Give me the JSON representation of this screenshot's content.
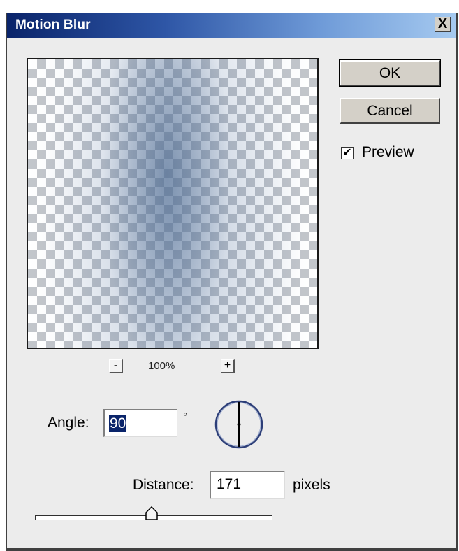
{
  "window": {
    "title": "Motion Blur",
    "close_glyph": "X"
  },
  "buttons": {
    "ok_label": "OK",
    "cancel_label": "Cancel"
  },
  "preview_option": {
    "label": "Preview",
    "checked": true,
    "check_glyph": "✔"
  },
  "zoom": {
    "minus_glyph": "-",
    "plus_glyph": "+",
    "level": "100%"
  },
  "angle": {
    "label": "Angle:",
    "value": "90",
    "unit_symbol": "°",
    "dial_icon": "angle-dial-icon"
  },
  "distance": {
    "label": "Distance:",
    "value": "171",
    "unit": "pixels",
    "slider_fraction": 0.49
  },
  "colors": {
    "title_bar_start": "#0a246a",
    "title_bar_end": "#a6caf0",
    "dialog_bg": "#ececec",
    "selection": "#0a246a"
  }
}
